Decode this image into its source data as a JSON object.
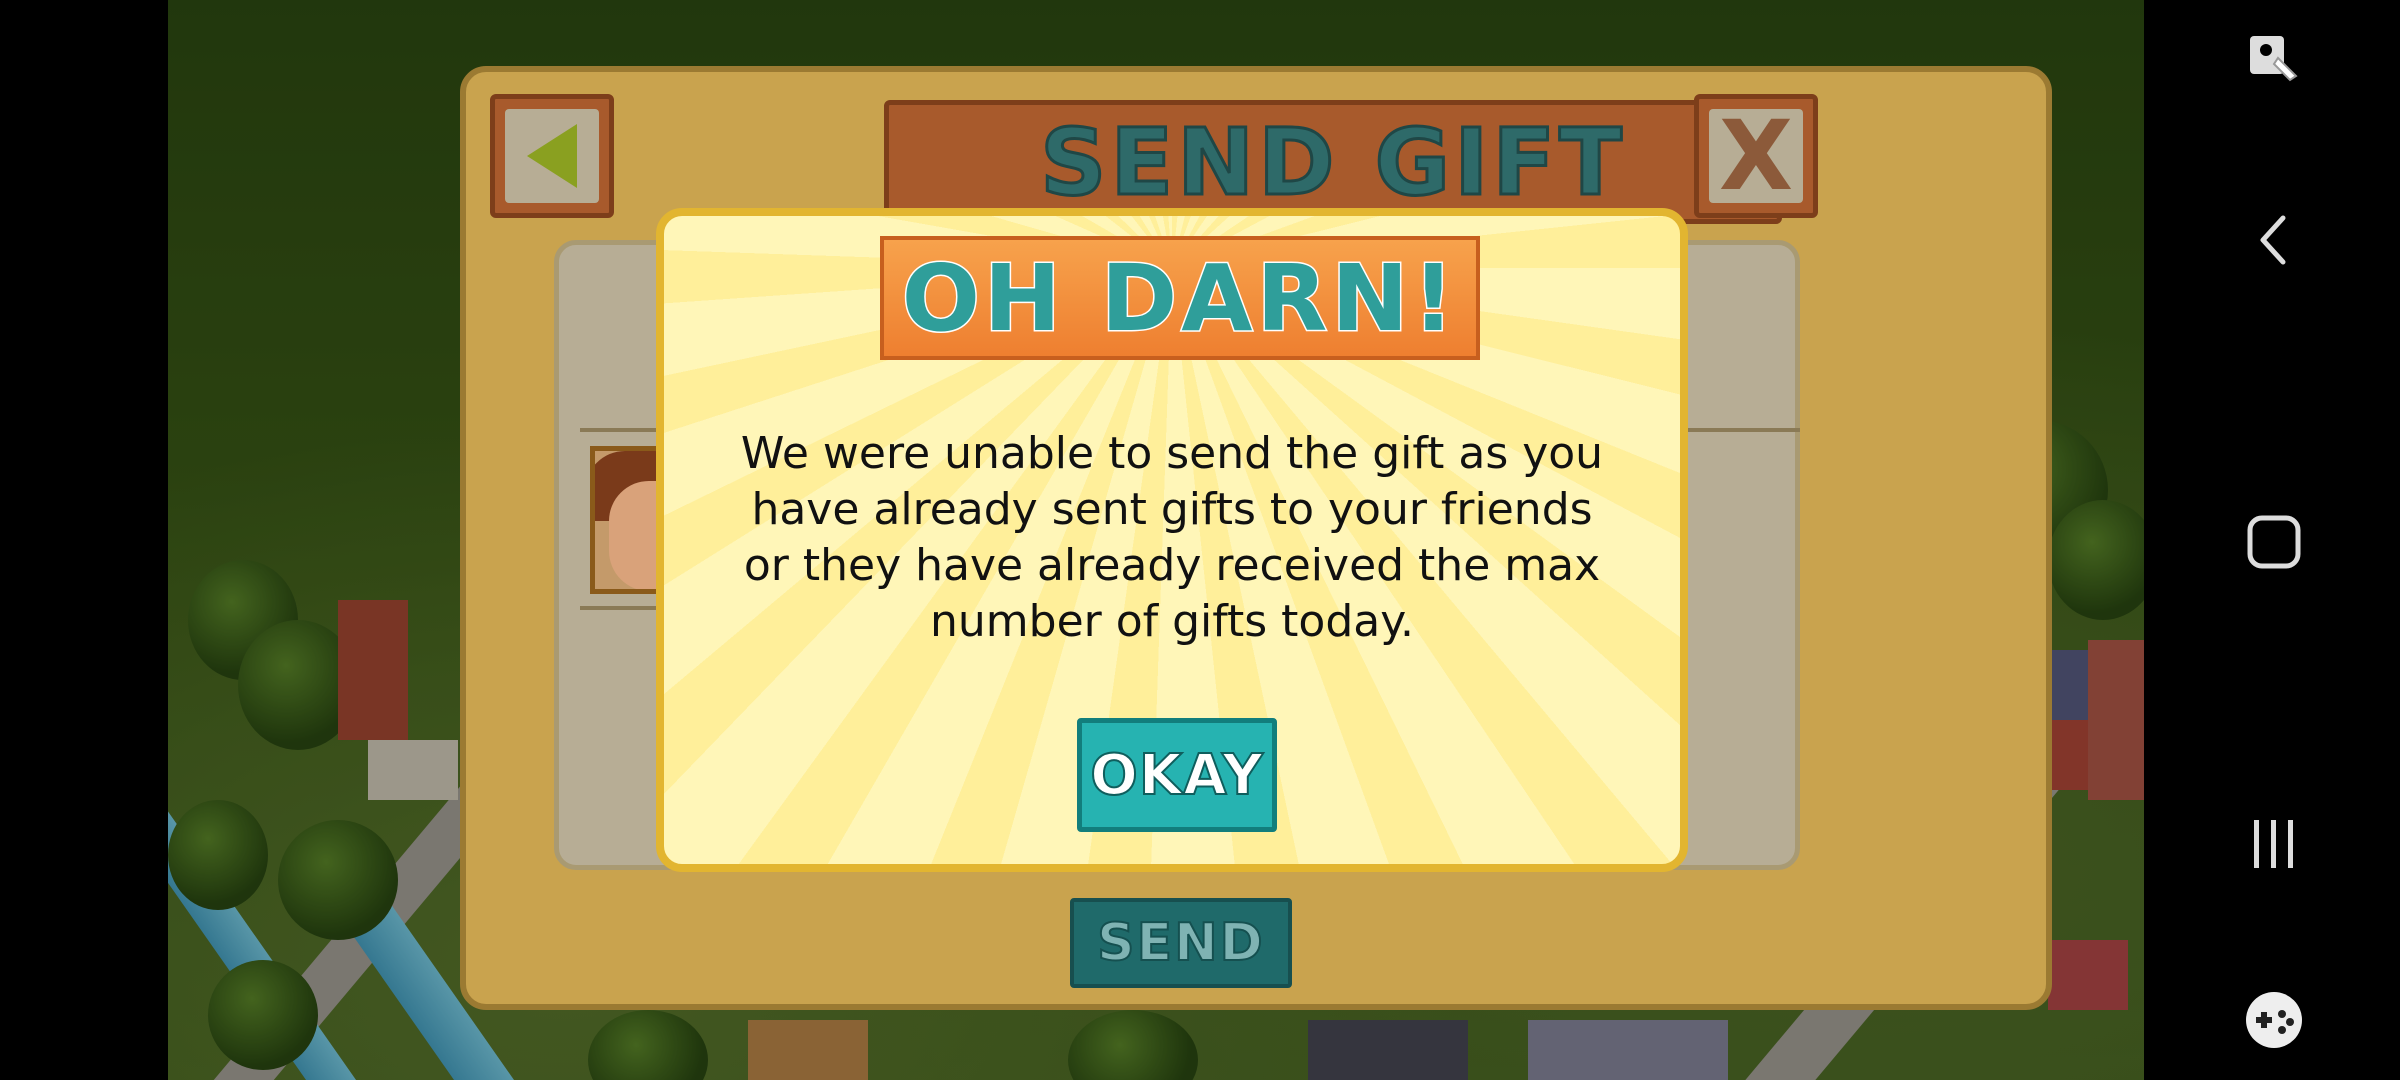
{
  "send_gift_panel": {
    "title": "SEND GIFT",
    "back_icon": "back-arrow-icon",
    "close_icon": "close-icon",
    "close_glyph": "X",
    "send_label": "SEND"
  },
  "oh_darn_dialog": {
    "title": "OH DARN!",
    "message": "We were unable to send the gift as you have already sent gifts to your friends or they have already received the max number of gifts today.",
    "okay_label": "OKAY"
  },
  "colors": {
    "dialog_bg": "#fff3a8",
    "dialog_border": "#e2b530",
    "title_orange": "#ee7f30",
    "okay_teal": "#26b3b1",
    "panel_tan": "#c9a34e"
  },
  "nav_bar": {
    "items": [
      "screen-pin-icon",
      "back-nav-icon",
      "home-nav-icon",
      "recent-apps-icon",
      "game-tools-icon"
    ]
  }
}
